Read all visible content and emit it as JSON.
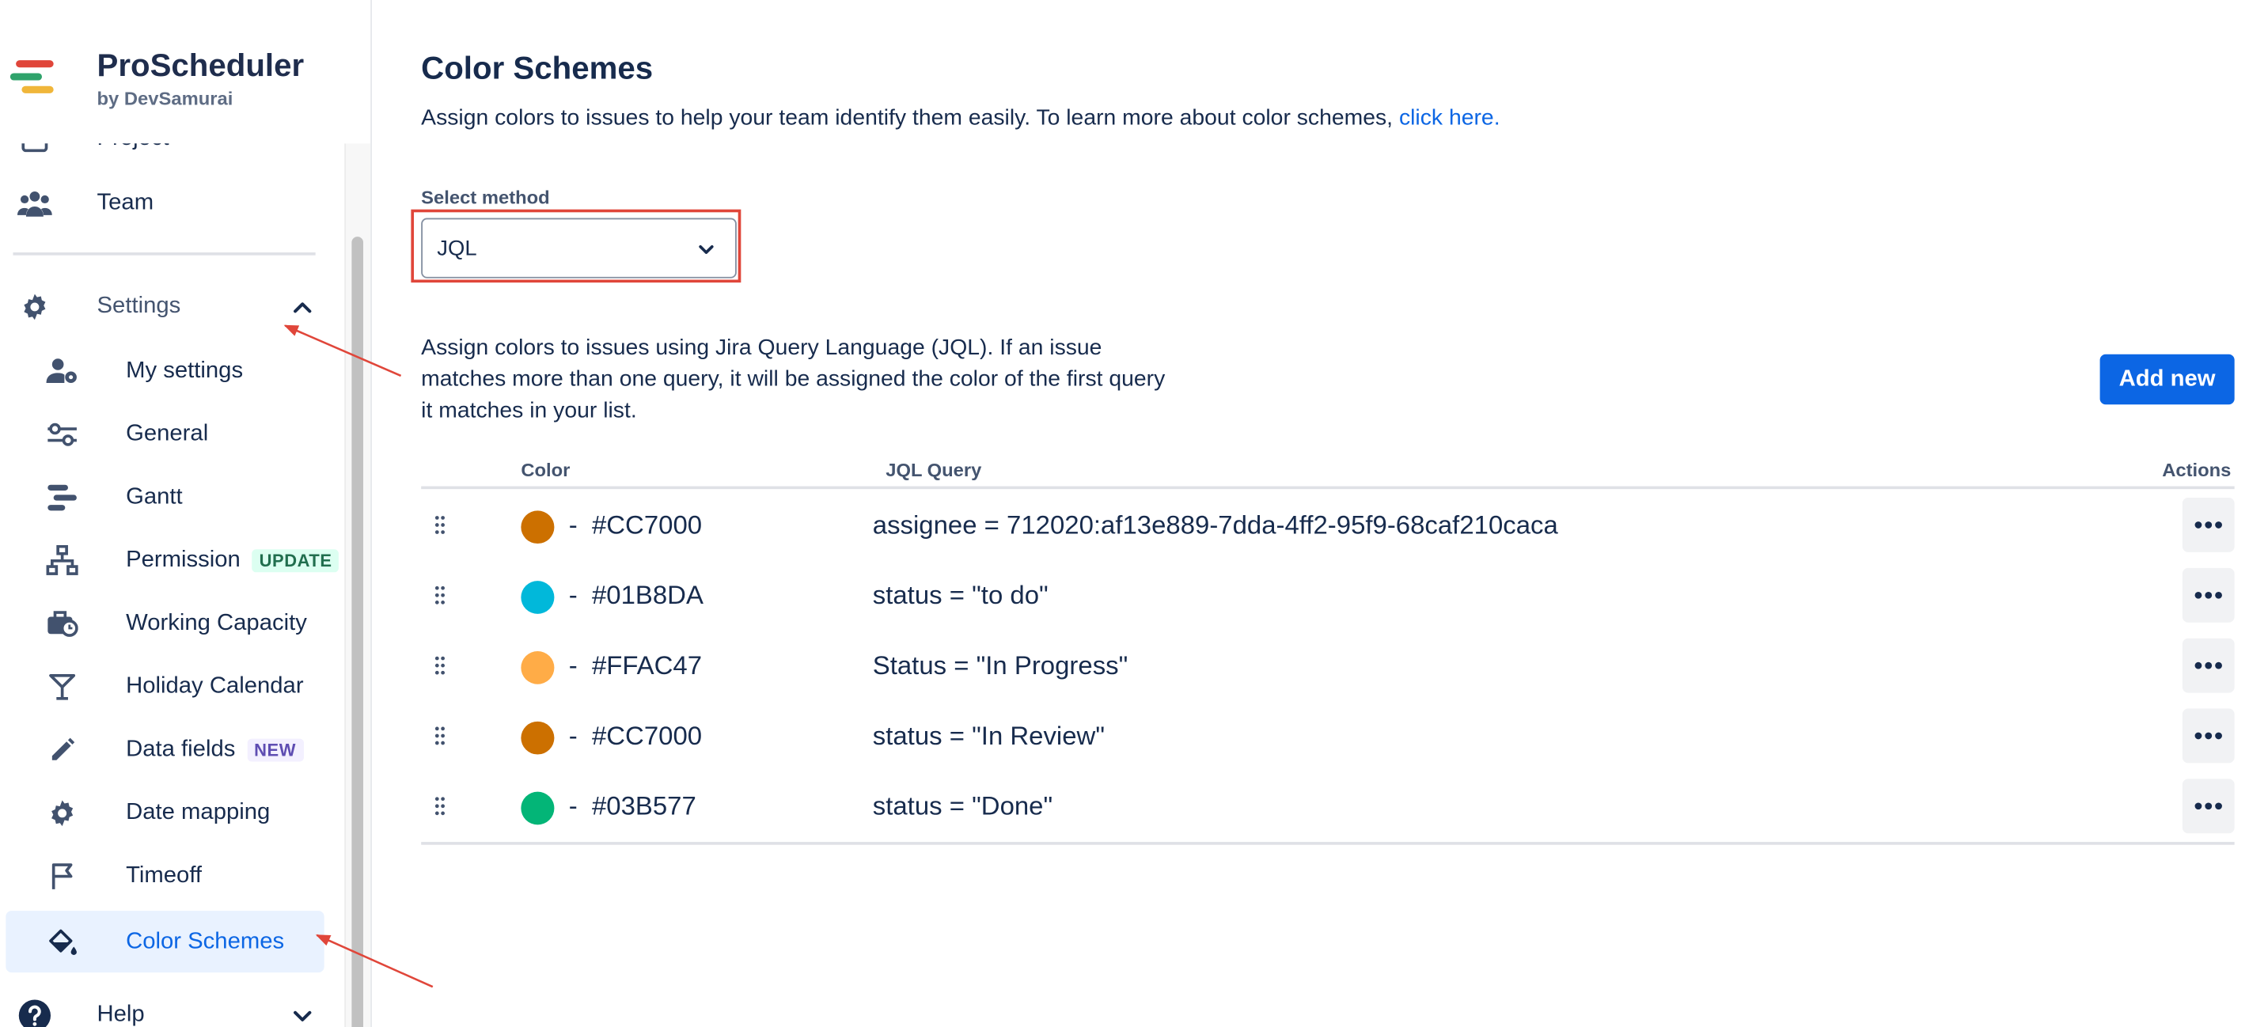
{
  "brand": {
    "title": "ProScheduler",
    "subtitle": "by DevSamurai"
  },
  "sidebar": {
    "top_items": [
      {
        "label": "Project",
        "icon": "board-icon"
      },
      {
        "label": "Team",
        "icon": "people-icon"
      }
    ],
    "settings": {
      "label": "Settings",
      "icon": "gear-icon",
      "expanded": true
    },
    "settings_items": [
      {
        "label": "My settings",
        "icon": "user-settings-icon"
      },
      {
        "label": "General",
        "icon": "sliders-icon"
      },
      {
        "label": "Gantt",
        "icon": "gantt-icon"
      },
      {
        "label": "Permission",
        "icon": "hierarchy-icon",
        "badge": "UPDATE"
      },
      {
        "label": "Working Capacity",
        "icon": "briefcase-clock-icon"
      },
      {
        "label": "Holiday Calendar",
        "icon": "cocktail-icon"
      },
      {
        "label": "Data fields",
        "icon": "pencil-icon",
        "badge": "NEW"
      },
      {
        "label": "Date mapping",
        "icon": "gear-icon"
      },
      {
        "label": "Timeoff",
        "icon": "flag-icon"
      },
      {
        "label": "Color Schemes",
        "icon": "paint-bucket-icon",
        "active": true
      }
    ],
    "help": {
      "label": "Help",
      "icon": "question-icon"
    }
  },
  "main": {
    "title": "Color Schemes",
    "description": "Assign colors to issues to help your team identify them easily. To learn more about color schemes,",
    "link_text": "click here.",
    "select_label": "Select method",
    "select_value": "JQL",
    "jql_description": "Assign colors to issues using Jira Query Language (JQL). If an issue matches more than one query, it will be assigned the color of the first query it matches in your list.",
    "add_button": "Add new",
    "table": {
      "headers": {
        "color": "Color",
        "query": "JQL Query",
        "actions": "Actions"
      },
      "rows": [
        {
          "color": "#CC7000",
          "hex_label": "#CC7000",
          "query": "assignee = 712020:af13e889-7dda-4ff2-95f9-68caf210caca"
        },
        {
          "color": "#01B8DA",
          "hex_label": "#01B8DA",
          "query": "status = \"to do\""
        },
        {
          "color": "#FFAC47",
          "hex_label": "#FFAC47",
          "query": "Status = \"In Progress\""
        },
        {
          "color": "#CC7000",
          "hex_label": "#CC7000",
          "query": "status = \"In Review\""
        },
        {
          "color": "#03B577",
          "hex_label": "#03B577",
          "query": "status = \"Done\""
        }
      ]
    }
  },
  "colors": {
    "accent": "#0c66e4",
    "annotation": "#e0463a"
  }
}
